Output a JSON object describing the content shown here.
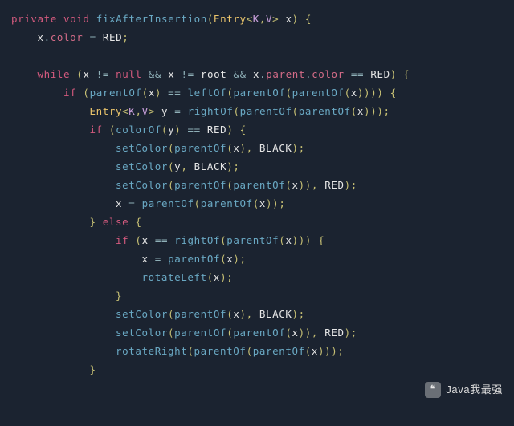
{
  "code": {
    "tokens": [
      [
        [
          "kw",
          "private"
        ],
        [
          "sp",
          " "
        ],
        [
          "kw",
          "void"
        ],
        [
          "sp",
          " "
        ],
        [
          "fn",
          "fixAfterInsertion"
        ],
        [
          "pn",
          "("
        ],
        [
          "type",
          "Entry"
        ],
        [
          "pn",
          "<"
        ],
        [
          "num",
          "K"
        ],
        [
          "pn",
          ","
        ],
        [
          "num",
          "V"
        ],
        [
          "pn",
          ">"
        ],
        [
          "sp",
          " "
        ],
        [
          "id",
          "x"
        ],
        [
          "pn",
          ")"
        ],
        [
          "sp",
          " "
        ],
        [
          "pn",
          "{"
        ]
      ],
      [
        [
          "sp",
          "    "
        ],
        [
          "id",
          "x"
        ],
        [
          "op",
          "."
        ],
        [
          "field",
          "color"
        ],
        [
          "sp",
          " "
        ],
        [
          "op",
          "="
        ],
        [
          "sp",
          " "
        ],
        [
          "const",
          "RED"
        ],
        [
          "pn",
          ";"
        ]
      ],
      [],
      [
        [
          "sp",
          "    "
        ],
        [
          "kw",
          "while"
        ],
        [
          "sp",
          " "
        ],
        [
          "pn",
          "("
        ],
        [
          "id",
          "x"
        ],
        [
          "sp",
          " "
        ],
        [
          "op",
          "!="
        ],
        [
          "sp",
          " "
        ],
        [
          "kw",
          "null"
        ],
        [
          "sp",
          " "
        ],
        [
          "op",
          "&&"
        ],
        [
          "sp",
          " "
        ],
        [
          "id",
          "x"
        ],
        [
          "sp",
          " "
        ],
        [
          "op",
          "!="
        ],
        [
          "sp",
          " "
        ],
        [
          "id",
          "root"
        ],
        [
          "sp",
          " "
        ],
        [
          "op",
          "&&"
        ],
        [
          "sp",
          " "
        ],
        [
          "id",
          "x"
        ],
        [
          "op",
          "."
        ],
        [
          "field",
          "parent"
        ],
        [
          "op",
          "."
        ],
        [
          "field",
          "color"
        ],
        [
          "sp",
          " "
        ],
        [
          "op",
          "=="
        ],
        [
          "sp",
          " "
        ],
        [
          "const",
          "RED"
        ],
        [
          "pn",
          ")"
        ],
        [
          "sp",
          " "
        ],
        [
          "pn",
          "{"
        ]
      ],
      [
        [
          "sp",
          "        "
        ],
        [
          "kw",
          "if"
        ],
        [
          "sp",
          " "
        ],
        [
          "pn",
          "("
        ],
        [
          "fn",
          "parentOf"
        ],
        [
          "pn",
          "("
        ],
        [
          "id",
          "x"
        ],
        [
          "pn",
          ")"
        ],
        [
          "sp",
          " "
        ],
        [
          "op",
          "=="
        ],
        [
          "sp",
          " "
        ],
        [
          "fn",
          "leftOf"
        ],
        [
          "pn",
          "("
        ],
        [
          "fn",
          "parentOf"
        ],
        [
          "pn",
          "("
        ],
        [
          "fn",
          "parentOf"
        ],
        [
          "pn",
          "("
        ],
        [
          "id",
          "x"
        ],
        [
          "pn",
          ")"
        ],
        [
          "pn",
          ")"
        ],
        [
          "pn",
          ")"
        ],
        [
          "pn",
          ")"
        ],
        [
          "sp",
          " "
        ],
        [
          "pn",
          "{"
        ]
      ],
      [
        [
          "sp",
          "            "
        ],
        [
          "type",
          "Entry"
        ],
        [
          "pn",
          "<"
        ],
        [
          "num",
          "K"
        ],
        [
          "pn",
          ","
        ],
        [
          "num",
          "V"
        ],
        [
          "pn",
          ">"
        ],
        [
          "sp",
          " "
        ],
        [
          "id",
          "y"
        ],
        [
          "sp",
          " "
        ],
        [
          "op",
          "="
        ],
        [
          "sp",
          " "
        ],
        [
          "fn",
          "rightOf"
        ],
        [
          "pn",
          "("
        ],
        [
          "fn",
          "parentOf"
        ],
        [
          "pn",
          "("
        ],
        [
          "fn",
          "parentOf"
        ],
        [
          "pn",
          "("
        ],
        [
          "id",
          "x"
        ],
        [
          "pn",
          ")"
        ],
        [
          "pn",
          ")"
        ],
        [
          "pn",
          ")"
        ],
        [
          "pn",
          ";"
        ]
      ],
      [
        [
          "sp",
          "            "
        ],
        [
          "kw",
          "if"
        ],
        [
          "sp",
          " "
        ],
        [
          "pn",
          "("
        ],
        [
          "fn",
          "colorOf"
        ],
        [
          "pn",
          "("
        ],
        [
          "id",
          "y"
        ],
        [
          "pn",
          ")"
        ],
        [
          "sp",
          " "
        ],
        [
          "op",
          "=="
        ],
        [
          "sp",
          " "
        ],
        [
          "const",
          "RED"
        ],
        [
          "pn",
          ")"
        ],
        [
          "sp",
          " "
        ],
        [
          "pn",
          "{"
        ]
      ],
      [
        [
          "sp",
          "                "
        ],
        [
          "fn",
          "setColor"
        ],
        [
          "pn",
          "("
        ],
        [
          "fn",
          "parentOf"
        ],
        [
          "pn",
          "("
        ],
        [
          "id",
          "x"
        ],
        [
          "pn",
          ")"
        ],
        [
          "pn",
          ","
        ],
        [
          "sp",
          " "
        ],
        [
          "const",
          "BLACK"
        ],
        [
          "pn",
          ")"
        ],
        [
          "pn",
          ";"
        ]
      ],
      [
        [
          "sp",
          "                "
        ],
        [
          "fn",
          "setColor"
        ],
        [
          "pn",
          "("
        ],
        [
          "id",
          "y"
        ],
        [
          "pn",
          ","
        ],
        [
          "sp",
          " "
        ],
        [
          "const",
          "BLACK"
        ],
        [
          "pn",
          ")"
        ],
        [
          "pn",
          ";"
        ]
      ],
      [
        [
          "sp",
          "                "
        ],
        [
          "fn",
          "setColor"
        ],
        [
          "pn",
          "("
        ],
        [
          "fn",
          "parentOf"
        ],
        [
          "pn",
          "("
        ],
        [
          "fn",
          "parentOf"
        ],
        [
          "pn",
          "("
        ],
        [
          "id",
          "x"
        ],
        [
          "pn",
          ")"
        ],
        [
          "pn",
          ")"
        ],
        [
          "pn",
          ","
        ],
        [
          "sp",
          " "
        ],
        [
          "const",
          "RED"
        ],
        [
          "pn",
          ")"
        ],
        [
          "pn",
          ";"
        ]
      ],
      [
        [
          "sp",
          "                "
        ],
        [
          "id",
          "x"
        ],
        [
          "sp",
          " "
        ],
        [
          "op",
          "="
        ],
        [
          "sp",
          " "
        ],
        [
          "fn",
          "parentOf"
        ],
        [
          "pn",
          "("
        ],
        [
          "fn",
          "parentOf"
        ],
        [
          "pn",
          "("
        ],
        [
          "id",
          "x"
        ],
        [
          "pn",
          ")"
        ],
        [
          "pn",
          ")"
        ],
        [
          "pn",
          ";"
        ]
      ],
      [
        [
          "sp",
          "            "
        ],
        [
          "pn",
          "}"
        ],
        [
          "sp",
          " "
        ],
        [
          "kw",
          "else"
        ],
        [
          "sp",
          " "
        ],
        [
          "pn",
          "{"
        ]
      ],
      [
        [
          "sp",
          "                "
        ],
        [
          "kw",
          "if"
        ],
        [
          "sp",
          " "
        ],
        [
          "pn",
          "("
        ],
        [
          "id",
          "x"
        ],
        [
          "sp",
          " "
        ],
        [
          "op",
          "=="
        ],
        [
          "sp",
          " "
        ],
        [
          "fn",
          "rightOf"
        ],
        [
          "pn",
          "("
        ],
        [
          "fn",
          "parentOf"
        ],
        [
          "pn",
          "("
        ],
        [
          "id",
          "x"
        ],
        [
          "pn",
          ")"
        ],
        [
          "pn",
          ")"
        ],
        [
          "pn",
          ")"
        ],
        [
          "sp",
          " "
        ],
        [
          "pn",
          "{"
        ]
      ],
      [
        [
          "sp",
          "                    "
        ],
        [
          "id",
          "x"
        ],
        [
          "sp",
          " "
        ],
        [
          "op",
          "="
        ],
        [
          "sp",
          " "
        ],
        [
          "fn",
          "parentOf"
        ],
        [
          "pn",
          "("
        ],
        [
          "id",
          "x"
        ],
        [
          "pn",
          ")"
        ],
        [
          "pn",
          ";"
        ]
      ],
      [
        [
          "sp",
          "                    "
        ],
        [
          "fn",
          "rotateLeft"
        ],
        [
          "pn",
          "("
        ],
        [
          "id",
          "x"
        ],
        [
          "pn",
          ")"
        ],
        [
          "pn",
          ";"
        ]
      ],
      [
        [
          "sp",
          "                "
        ],
        [
          "pn",
          "}"
        ]
      ],
      [
        [
          "sp",
          "                "
        ],
        [
          "fn",
          "setColor"
        ],
        [
          "pn",
          "("
        ],
        [
          "fn",
          "parentOf"
        ],
        [
          "pn",
          "("
        ],
        [
          "id",
          "x"
        ],
        [
          "pn",
          ")"
        ],
        [
          "pn",
          ","
        ],
        [
          "sp",
          " "
        ],
        [
          "const",
          "BLACK"
        ],
        [
          "pn",
          ")"
        ],
        [
          "pn",
          ";"
        ]
      ],
      [
        [
          "sp",
          "                "
        ],
        [
          "fn",
          "setColor"
        ],
        [
          "pn",
          "("
        ],
        [
          "fn",
          "parentOf"
        ],
        [
          "pn",
          "("
        ],
        [
          "fn",
          "parentOf"
        ],
        [
          "pn",
          "("
        ],
        [
          "id",
          "x"
        ],
        [
          "pn",
          ")"
        ],
        [
          "pn",
          ")"
        ],
        [
          "pn",
          ","
        ],
        [
          "sp",
          " "
        ],
        [
          "const",
          "RED"
        ],
        [
          "pn",
          ")"
        ],
        [
          "pn",
          ";"
        ]
      ],
      [
        [
          "sp",
          "                "
        ],
        [
          "fn",
          "rotateRight"
        ],
        [
          "pn",
          "("
        ],
        [
          "fn",
          "parentOf"
        ],
        [
          "pn",
          "("
        ],
        [
          "fn",
          "parentOf"
        ],
        [
          "pn",
          "("
        ],
        [
          "id",
          "x"
        ],
        [
          "pn",
          ")"
        ],
        [
          "pn",
          ")"
        ],
        [
          "pn",
          ")"
        ],
        [
          "pn",
          ";"
        ]
      ],
      [
        [
          "sp",
          "            "
        ],
        [
          "pn",
          "}"
        ]
      ]
    ]
  },
  "watermark": {
    "icon_char": "❝",
    "text": "Java我最强"
  }
}
